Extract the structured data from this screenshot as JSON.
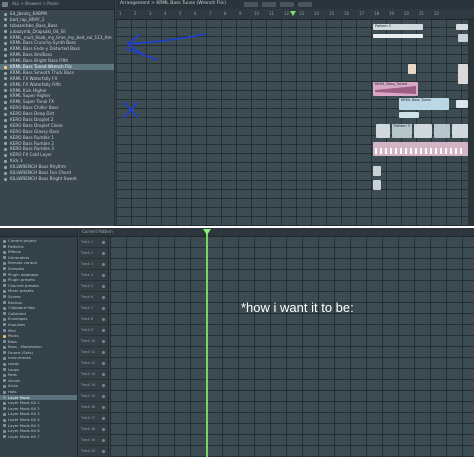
{
  "top": {
    "browser_path": "ALL > Browser > Packs",
    "playlist_title": "Arrangement > KRML Bass Tunes (Wrench Flic)",
    "ruler_numbers": [
      "1",
      "2",
      "3",
      "4",
      "5",
      "6",
      "7",
      "8",
      "9",
      "10",
      "11",
      "12",
      "13",
      "14",
      "15",
      "16",
      "17",
      "18",
      "19",
      "20",
      "21",
      "22"
    ],
    "files": [
      "Ed_Jbeaty_64BPM",
      "bad_rap_BRAY_2",
      "tobazerbbo_Bass_Bass",
      "jubazymb_Drapsaki_04_Sil",
      "KRML_mult_Rasb_my_time_my_bed_sol_113_Am",
      "KRML Bass Crunchy-Synth Bass",
      "KRML Bass Ends-y Distorted Bass",
      "KRML Bass Bm/Bass",
      "KRML Bass Bright Bass Fifth",
      "KRML Bass Tuned Wrench Flic",
      "KRML Bass Smooth Thick Bass",
      "KRML FX Waterfally FX",
      "KRML FX Waterfally Fifth",
      "KRML Kick Higher",
      "KRML Super Higher",
      "KRML Super Tonal FX",
      "KERO Bass Chiller Bass",
      "KERO Bass Deep Dirt",
      "KERO Bass Droplet 2",
      "KERO Bass Droplet Clone",
      "KERO Bass Glassy Bass",
      "KERO Bass Rumble 1",
      "KERO Bass Rumble 2",
      "KERO Bass Rumble 3",
      "KERO FX Cold Layer",
      "Kick 1",
      "KILLWRENCH Bass Rhythm",
      "KILLWRENCH Bass Fun Chord",
      "KILLWRENCH Bass Bright Sweet"
    ],
    "selected_index": 9,
    "clips": [
      "Pattern 2",
      "KRML_Bass_Tuned",
      "KRML Bass Tunes",
      "Pattern 3"
    ]
  },
  "bottom": {
    "ruler_label": "Current Pattern",
    "browser_items": [
      "Current project",
      "Patterns",
      "Effects",
      "Generators",
      "Remote control",
      "Samples",
      "Plugin database",
      "Plugin presets",
      "Channel presets",
      "Mixer presets",
      "Scores",
      "Backup",
      "Clipboard files",
      "Collected",
      "Envelopes",
      "Impulses",
      "Misc",
      "Packs",
      "Bass",
      "Bass - Modulation",
      "Drums (Sets)",
      "Instruments",
      "Leads",
      "Loops",
      "Pads",
      "Vocals",
      "Kicks",
      "Hats",
      "Layer Mods",
      "Layer Mods Kit 1",
      "Layer Mods Kit 2",
      "Layer Mods Kit 3",
      "Layer Mods Kit 4",
      "Layer Mods Kit 5",
      "Layer Mods Kit 6",
      "Layer Mods Kit 7"
    ],
    "open_index": 17,
    "selected_index": 28,
    "track_labels": [
      "Track 1",
      "Track 2",
      "Track 3",
      "Track 4",
      "Track 5",
      "Track 6",
      "Track 7",
      "Track 8",
      "Track 9",
      "Track 10",
      "Track 11",
      "Track 12",
      "Track 13",
      "Track 14",
      "Track 15",
      "Track 16",
      "Track 17",
      "Track 18",
      "Track 19",
      "Track 20"
    ]
  },
  "caption": "*how i want it to be:",
  "colors": {
    "playhead": "#78d464",
    "annotation_ink": "#1c3fd8",
    "panel": "#3b4950"
  }
}
